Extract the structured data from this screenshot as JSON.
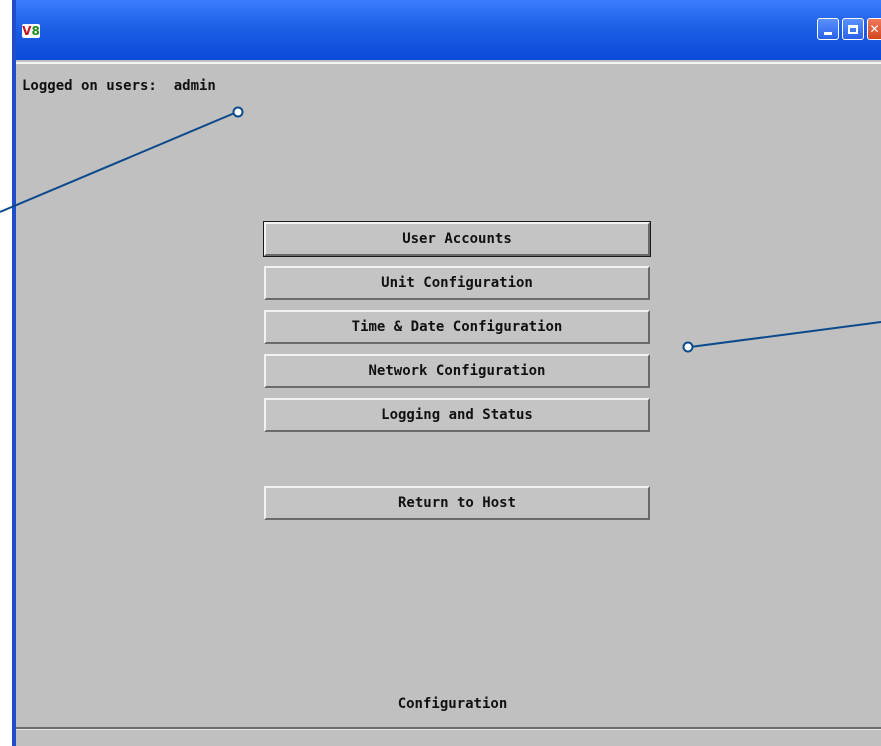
{
  "window": {
    "icon_text_v": "V",
    "icon_text_n": "8",
    "controls": [
      "minimize-icon",
      "maximize-icon",
      "close-icon"
    ]
  },
  "header": {
    "logged_on_label": "Logged on users:",
    "logged_on_value": "admin"
  },
  "menu": {
    "items": [
      {
        "label": "User Accounts"
      },
      {
        "label": "Unit Configuration"
      },
      {
        "label": "Time & Date Configuration"
      },
      {
        "label": "Network Configuration"
      },
      {
        "label": "Logging and Status"
      }
    ],
    "return_label": "Return to Host"
  },
  "footer": {
    "status": "Configuration"
  },
  "colors": {
    "titlebar": "#1d5fe6",
    "window_bg": "#c0c0c0",
    "callout_line": "#0c4a8c"
  }
}
